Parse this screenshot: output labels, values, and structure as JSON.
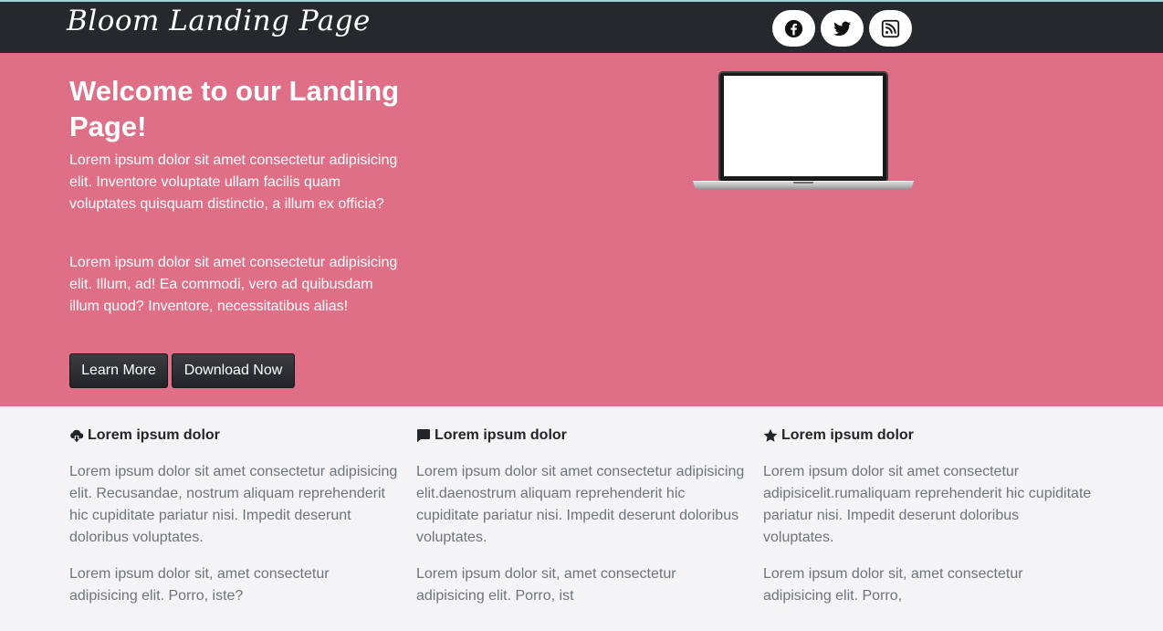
{
  "navbar": {
    "brand": "Bloom Landing Page",
    "social": [
      {
        "icon": "facebook-icon"
      },
      {
        "icon": "twitter-icon"
      },
      {
        "icon": "rss-icon"
      }
    ]
  },
  "hero": {
    "title": "Welcome to our Landing Page!",
    "paragraph1": "Lorem ipsum dolor sit amet consectetur adipisicing elit. Inventore voluptate ullam facilis quam voluptates quisquam distinctio, a illum ex officia?",
    "paragraph2": "Lorem ipsum dolor sit amet consectetur adipisicing elit. Illum, ad! Ea commodi, vero ad quibusdam illum quod? Inventore, necessitatibus alias!",
    "learn_more_label": "Learn More",
    "download_label": "Download Now",
    "background_color": "#df6f86"
  },
  "features": [
    {
      "icon": "cloud-download-icon",
      "heading": "Lorem ipsum dolor",
      "text1": "Lorem ipsum dolor sit amet consectetur adipisicing elit. Recusandae, nostrum aliquam reprehenderit hic cupiditate pariatur nisi. Impedit deserunt doloribus voluptates.",
      "text2": "Lorem ipsum dolor sit, amet consectetur adipisicing elit. Porro, iste?"
    },
    {
      "icon": "comment-icon",
      "heading": "Lorem ipsum dolor",
      "text1": "Lorem ipsum dolor sit amet consectetur adipisicing elit.daenostrum aliquam reprehenderit hic cupiditate pariatur nisi. Impedit deserunt doloribus voluptates.",
      "text2": "Lorem ipsum dolor sit, amet consectetur adipisicing elit. Porro, ist"
    },
    {
      "icon": "star-icon",
      "heading": "Lorem ipsum dolor",
      "text1": "Lorem ipsum dolor sit amet consectetur adipisicelit.rumaliquam reprehenderit hic cupiditate pariatur nisi. Impedit deserunt doloribus voluptates.",
      "text2": "Lorem ipsum dolor sit, amet consectetur adipisicing elit. Porro,"
    }
  ]
}
